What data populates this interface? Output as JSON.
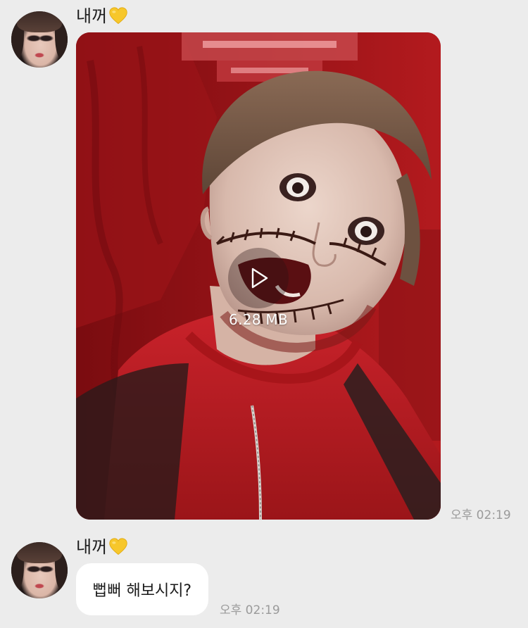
{
  "messages": [
    {
      "sender": {
        "name": "내꺼",
        "heart": "yellow-heart-emoji",
        "avatar": "profile-photo"
      },
      "type": "video",
      "video": {
        "size": "6.28 MB",
        "play_icon": "play-icon"
      },
      "timestamp": "오후 02:19"
    },
    {
      "sender": {
        "name": "내꺼",
        "heart": "yellow-heart-emoji",
        "avatar": "profile-photo"
      },
      "type": "text",
      "text": "뻡뻐 해보시지?",
      "timestamp": "오후 02:19"
    }
  ],
  "colors": {
    "background": "#ececec",
    "bubble": "#ffffff",
    "timestamp": "#9a9a9a",
    "heart": "#f5c518"
  }
}
